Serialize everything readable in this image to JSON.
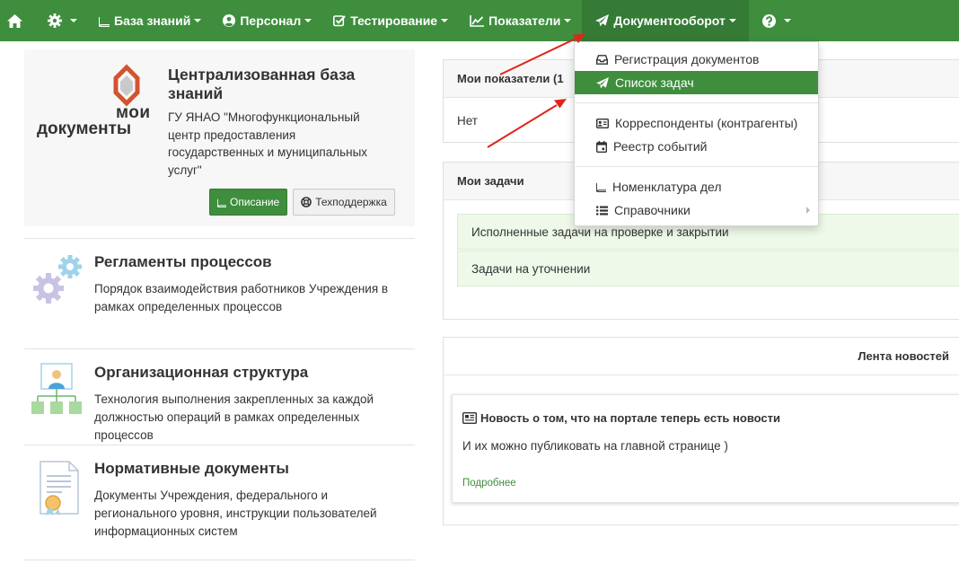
{
  "navbar": {
    "items": [
      {
        "label": "База знаний"
      },
      {
        "label": "Персонал"
      },
      {
        "label": "Тестирование"
      },
      {
        "label": "Показатели"
      },
      {
        "label": "Документооборот"
      }
    ]
  },
  "hero": {
    "logo_text_top": "мои",
    "logo_text_bottom": "документы",
    "title": "Централизованная база знаний",
    "org": "ГУ ЯНАО \"Многофункциональный центр предоставления государственных и муниципальных услуг\"",
    "btn_description": "Описание",
    "btn_support": "Техподдержка"
  },
  "sections": [
    {
      "title": "Регламенты процессов",
      "desc": "Порядок взаимодействия работников Учреждения в рамках определенных процессов"
    },
    {
      "title": "Организационная структура",
      "desc": "Технология выполнения закрепленных за каждой должностью операций в рамках определенных процессов"
    },
    {
      "title": "Нормативные документы",
      "desc": "Документы Учреждения, федерального и регионального уровня, инструкции пользователей информационных систем"
    }
  ],
  "my_indicators": {
    "title": "Мои показатели (1",
    "body": "Нет"
  },
  "my_tasks": {
    "title": "Мои задачи",
    "rows": [
      "Исполненные задачи на проверке и закрытии",
      "Задачи на уточнении"
    ]
  },
  "news": {
    "title": "Лента новостей",
    "item_title": "Новость о том, что на портале теперь есть новости",
    "item_body": "И их можно публиковать на главной странице )",
    "more_link": "Подробнее"
  },
  "dropdown": {
    "items": [
      {
        "label": "Регистрация документов",
        "icon": "inbox-icon"
      },
      {
        "label": "Список задач",
        "icon": "paper-plane-icon",
        "active": true
      },
      {
        "label": "Корреспонденты (контрагенты)",
        "icon": "address-card-icon"
      },
      {
        "label": "Реестр событий",
        "icon": "calendar-icon"
      },
      {
        "label": "Номенклатура дел",
        "icon": "book-icon"
      },
      {
        "label": "Справочники",
        "icon": "list-icon"
      }
    ]
  },
  "colors": {
    "brand_green": "#3e8e3e",
    "dark_green": "#357a35",
    "logo_orange": "#d2532f",
    "task_row_bg": "#eef9e9",
    "arrow_red": "#e0241b"
  }
}
